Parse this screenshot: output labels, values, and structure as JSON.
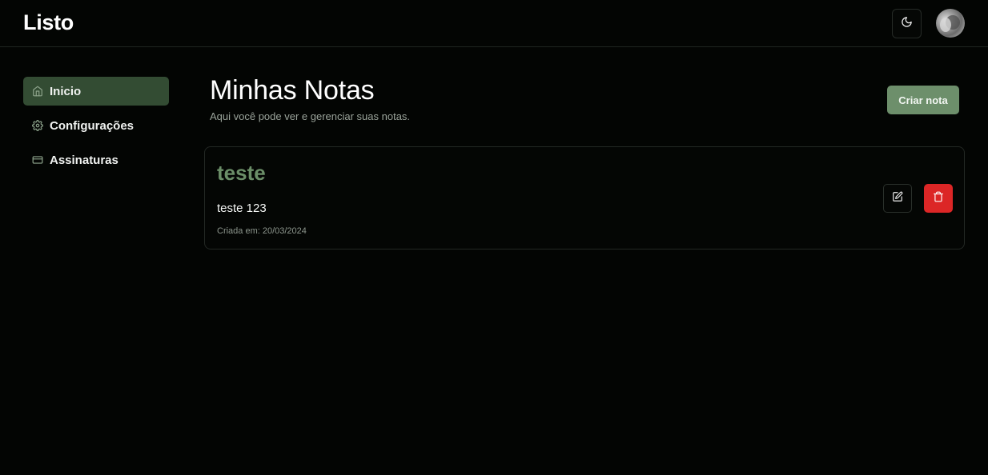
{
  "app": {
    "brand": "Listo"
  },
  "header": {
    "theme_icon": "moon-icon",
    "avatar_icon": "user-avatar"
  },
  "sidebar": {
    "items": [
      {
        "label": "Inicio",
        "icon": "home-icon",
        "active": true
      },
      {
        "label": "Configurações",
        "icon": "gear-icon",
        "active": false
      },
      {
        "label": "Assinaturas",
        "icon": "credit-card-icon",
        "active": false
      }
    ]
  },
  "main": {
    "title": "Minhas Notas",
    "subtitle": "Aqui você pode ver e gerenciar suas notas.",
    "create_label": "Criar nota",
    "notes": [
      {
        "title": "teste",
        "content": "teste 123",
        "date": "Criada em: 20/03/2024",
        "edit_icon": "edit-icon",
        "delete_icon": "trash-icon"
      }
    ]
  },
  "colors": {
    "background": "#030503",
    "accent": "#6d8f6b",
    "active_nav": "#334c33",
    "danger": "#dc2626"
  }
}
